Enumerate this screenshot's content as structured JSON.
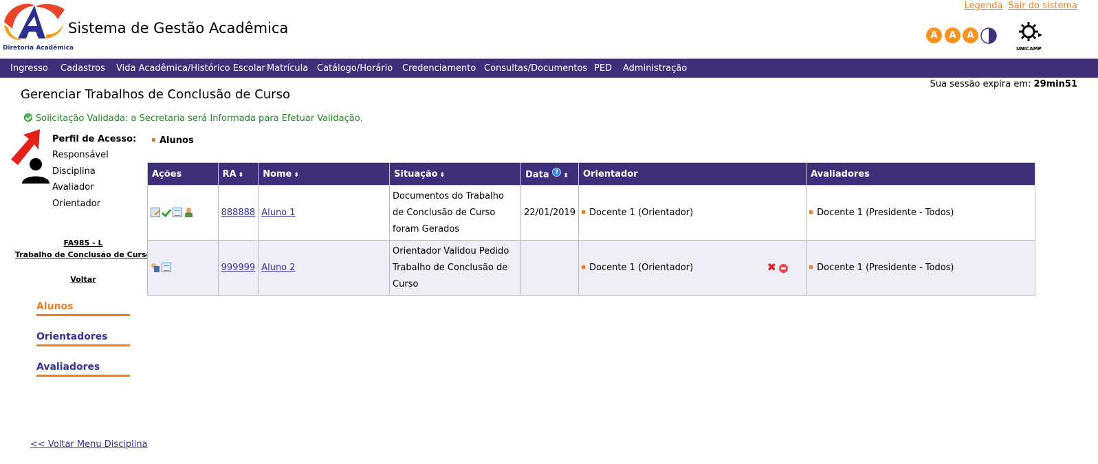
{
  "header": {
    "logo_caption": "Diretoria Acadêmica",
    "app_title": "Sistema de Gestão Acadêmica",
    "top_links": [
      "Legenda",
      "Sair do sistema"
    ],
    "accessibility": [
      "A",
      "A",
      "A"
    ],
    "university_logo_caption": "UNICAMP"
  },
  "nav": {
    "items": [
      "Ingresso",
      "Cadastros",
      "Vida Acadêmica/Histórico Escolar",
      "Matrícula",
      "Catálogo/Horário",
      "Credenciamento",
      "Consultas/Documentos",
      "PED",
      "Administração"
    ]
  },
  "page": {
    "title": "Gerenciar Trabalhos de Conclusão de Curso",
    "session_label": "Sua sessão expira em:",
    "session_time": "29min51",
    "success_message": "Solicitação Validada: a Secretaria será Informada para Efetuar Validação."
  },
  "sidebar": {
    "perfil_title": "Perfil de Acesso:",
    "perfil_items": [
      "Responsável",
      "Disciplina",
      "Avaliador",
      "Orientador"
    ],
    "discipline_code": "FA985 - L",
    "discipline_name": "Trabalho de Conclusão de Curso",
    "back_label": "Voltar",
    "tabs": [
      "Alunos",
      "Orientadores",
      "Avaliadores"
    ],
    "bottom_link": "<< Voltar Menu Disciplina"
  },
  "main": {
    "section_title": "Alunos",
    "columns": [
      "Ações",
      "RA",
      "Nome",
      "Situação",
      "Data",
      "Orientador",
      "Avaliadores"
    ],
    "rows": [
      {
        "ra": "888888",
        "name": "Aluno 1",
        "situation": "Documentos do Trabalho de Conclusão de Curso foram Gerados",
        "date": "22/01/2019",
        "advisor": "Docente 1 (Orientador)",
        "evaluators": "Docente 1 (Presidente - Todos)"
      },
      {
        "ra": "999999",
        "name": "Aluno 2",
        "situation": "Orientador Validou Pedido Trabalho de Conclusão de Curso",
        "date": "",
        "advisor": "Docente 1 (Orientador)",
        "evaluators": "Docente 1 (Presidente - Todos)"
      }
    ]
  },
  "colors": {
    "nav_bg": "#3f2e7a",
    "accent_orange": "#ee7e1b",
    "success_green": "#1b8a1b",
    "link_blue": "#333399"
  }
}
